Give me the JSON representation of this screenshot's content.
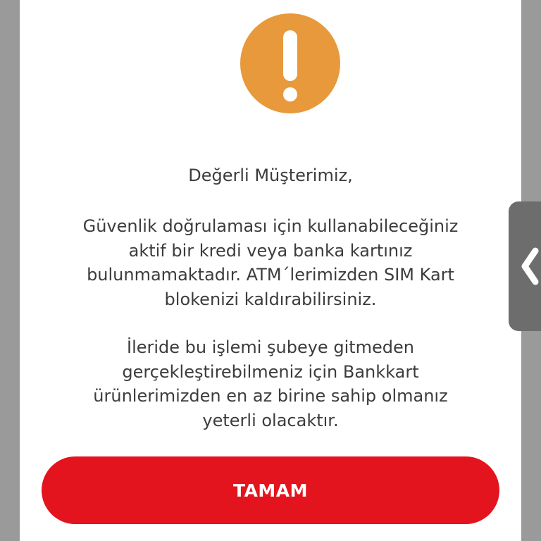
{
  "dialog": {
    "greeting": "Değerli Müşterimiz,",
    "paragraph1_lines": [
      "Güvenlik doğrulaması için kullanabileceğiniz",
      "aktif bir kredi veya banka kartınız",
      "bulunmamaktadır. ATM´lerimizden SIM Kart",
      "blokenizi kaldırabilirsiniz."
    ],
    "paragraph2_lines": [
      "İleride bu işlemi şubeye gitmeden",
      "gerçekleştirebilmeniz için Bankkart",
      "ürünlerimizden en az birine sahip olmanız",
      "yeterli olacaktır."
    ],
    "ok_label": "TAMAM",
    "icon": "exclamation-icon"
  },
  "side_handle": {
    "icon": "chevron-left-icon"
  },
  "colors": {
    "accent_red": "#e3141d",
    "warning_orange": "#e8993b",
    "backdrop_gray": "#9a9a9a",
    "handle_gray": "#6d6d6d"
  }
}
